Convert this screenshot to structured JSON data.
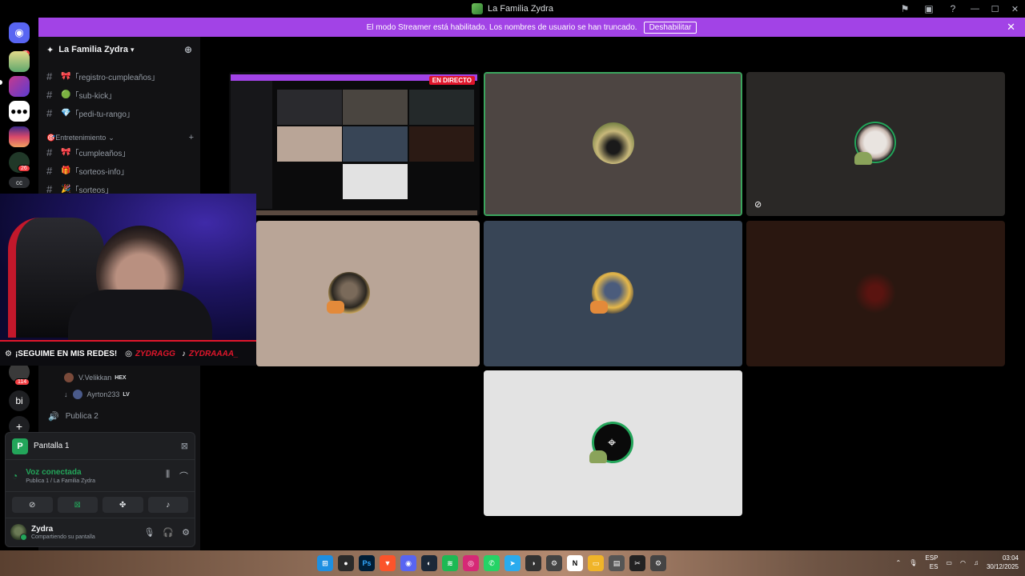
{
  "titlebar": {
    "title": "La Familia Zydra"
  },
  "banner": {
    "text": "El modo Streamer está habilitado. Los nombres de usuario se han truncado.",
    "button": "Deshabilitar"
  },
  "rail": {
    "home_badge": "3",
    "server_badge_1": "26",
    "server_badge_2": "114",
    "text_server": "bi"
  },
  "sidebar": {
    "server_name": "La Familia Zydra",
    "channels_top": [
      {
        "emoji": "🎀",
        "name": "「registro-cumpleaños」"
      },
      {
        "emoji": "🟢",
        "name": "「sub-kick」"
      },
      {
        "emoji": "💎",
        "name": "「pedi-tu-rango」"
      }
    ],
    "category_entretenimiento": "Entretenimiento",
    "channels_ent": [
      {
        "emoji": "🎀",
        "name": "「cumpleaños」"
      },
      {
        "emoji": "🎁",
        "name": "「sorteos-info」"
      },
      {
        "emoji": "🎉",
        "name": "「sorteos」"
      }
    ],
    "voice_users": [
      {
        "name": "V.Velikkan",
        "tag": "HEX"
      },
      {
        "name": "Ayrton233",
        "tag": "LV"
      }
    ],
    "voice_channel": "Publica 2"
  },
  "panel": {
    "screen_title": "Pantalla 1",
    "voice_status": "Voz conectada",
    "voice_location": "Publica 1 / La Familia Zydra",
    "username": "Zydra",
    "user_status": "Compartiendo su pantalla"
  },
  "stream": {
    "live_badge": "EN DIRECTO",
    "cam_text": "¡SEGUIME EN MIS REDES!",
    "instagram_handle": "ZYDRAGG",
    "tiktok_handle": "ZYDRAAAA_"
  },
  "taskbar": {
    "lang_top": "ESP",
    "lang_bottom": "ES",
    "time": "03:04",
    "date": "30/12/2025"
  }
}
